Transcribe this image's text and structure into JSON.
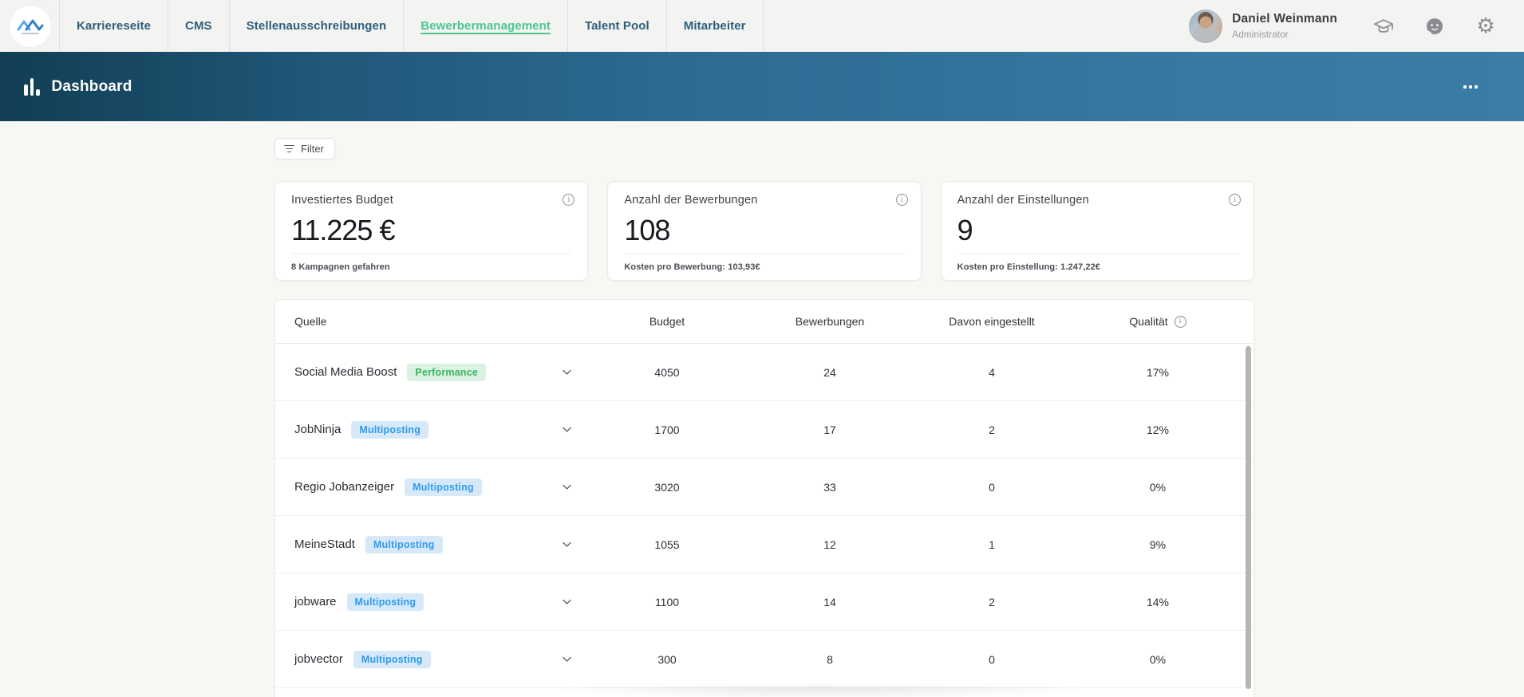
{
  "topnav": {
    "items": [
      {
        "label": "Karriereseite",
        "active": false
      },
      {
        "label": "CMS",
        "active": false
      },
      {
        "label": "Stellenausschreibungen",
        "active": false
      },
      {
        "label": "Bewerbermanagement",
        "active": true
      },
      {
        "label": "Talent Pool",
        "active": false
      },
      {
        "label": "Mitarbeiter",
        "active": false
      }
    ],
    "user": {
      "name": "Daniel Weinmann",
      "role": "Administrator"
    }
  },
  "header": {
    "title": "Dashboard"
  },
  "toolbar": {
    "filter_label": "Filter"
  },
  "stats": [
    {
      "title": "Investiertes Budget",
      "value": "11.225 €",
      "footer": "8 Kampagnen gefahren"
    },
    {
      "title": "Anzahl der Bewerbungen",
      "value": "108",
      "footer": "Kosten pro Bewerbung: 103,93€"
    },
    {
      "title": "Anzahl der Einstellungen",
      "value": "9",
      "footer": "Kosten pro Einstellung: 1.247,22€"
    }
  ],
  "table": {
    "columns": {
      "quelle": "Quelle",
      "budget": "Budget",
      "bewerbungen": "Bewerbungen",
      "davon": "Davon eingestellt",
      "qualitaet": "Qualität"
    },
    "rows": [
      {
        "name": "Social Media Boost",
        "badge": "Performance",
        "badge_class": "badge-performance",
        "budget": "4050",
        "applications": "24",
        "hired": "4",
        "quality": "17%"
      },
      {
        "name": "JobNinja",
        "badge": "Multiposting",
        "badge_class": "badge-multiposting",
        "budget": "1700",
        "applications": "17",
        "hired": "2",
        "quality": "12%"
      },
      {
        "name": "Regio Jobanzeiger",
        "badge": "Multiposting",
        "badge_class": "badge-multiposting",
        "budget": "3020",
        "applications": "33",
        "hired": "0",
        "quality": "0%"
      },
      {
        "name": "MeineStadt",
        "badge": "Multiposting",
        "badge_class": "badge-multiposting",
        "budget": "1055",
        "applications": "12",
        "hired": "1",
        "quality": "9%"
      },
      {
        "name": "jobware",
        "badge": "Multiposting",
        "badge_class": "badge-multiposting",
        "budget": "1100",
        "applications": "14",
        "hired": "2",
        "quality": "14%"
      },
      {
        "name": "jobvector",
        "badge": "Multiposting",
        "badge_class": "badge-multiposting",
        "budget": "300",
        "applications": "8",
        "hired": "0",
        "quality": "0%"
      }
    ]
  },
  "colors": {
    "accent_green": "#4cc690",
    "nav_text": "#2d5f7d",
    "header_gradient_left": "#113e54",
    "header_gradient_right": "#3a7da6",
    "badge_performance_bg": "#dbf2e2",
    "badge_performance_text": "#36b55f",
    "badge_multiposting_bg": "#d7e9f9",
    "badge_multiposting_text": "#2e9bf0"
  }
}
